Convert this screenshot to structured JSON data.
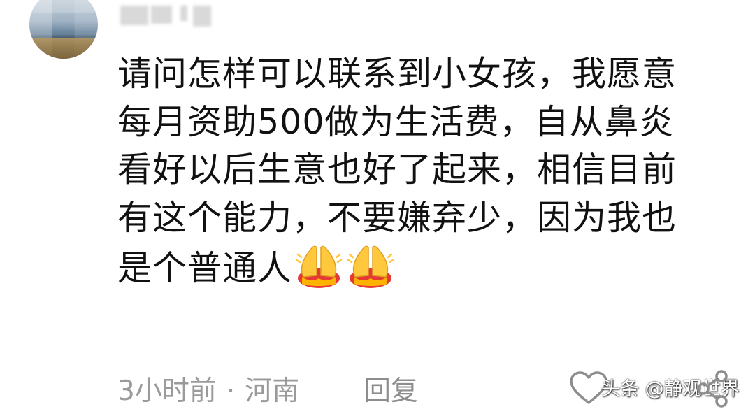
{
  "comment": {
    "lines": [
      "请问怎样可以联系到小女孩，我愿意",
      "每月资助500做为生活费，自从鼻炎",
      "看好以后生意也好了起来，相信目前",
      "有这个能力，不要嫌弃少，因为我也",
      "是个普通人"
    ],
    "emoji": [
      "folded-hands",
      "folded-hands"
    ]
  },
  "meta": {
    "time": "3小时前",
    "separator": "·",
    "location": "河南"
  },
  "actions": {
    "reply_label": "回复",
    "like_icon": "heart-outline-icon",
    "share_icon": "share-icon"
  },
  "watermark": {
    "text": "头条 @静观世界"
  },
  "colors": {
    "text": "#111111",
    "meta": "#9a9a9a",
    "emoji_yellow": "#ffc83d",
    "emoji_red": "#e53935"
  }
}
